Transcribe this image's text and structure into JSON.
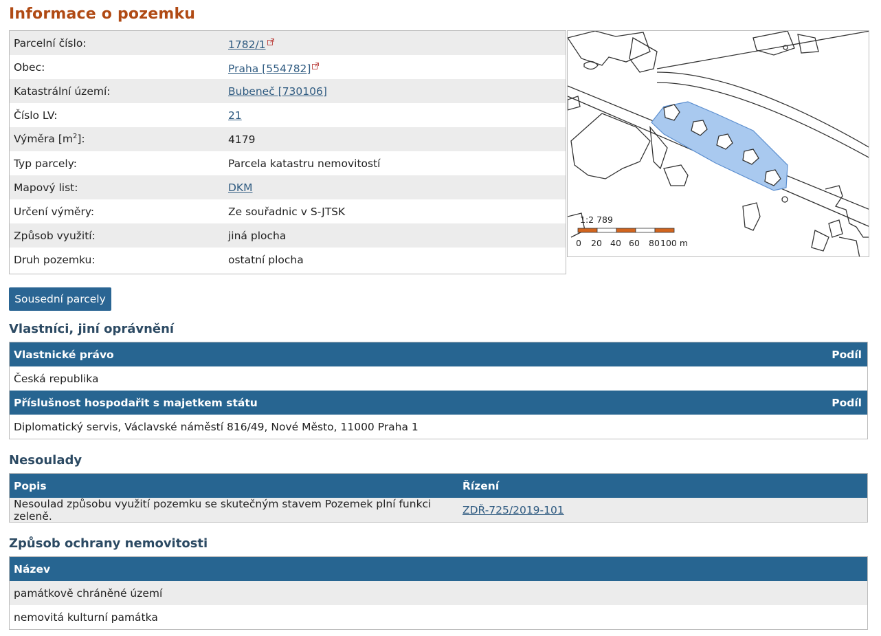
{
  "title": "Informace o pozemku",
  "parcel_info": [
    {
      "label": "Parcelní číslo:",
      "value": "1782/1",
      "link": true,
      "external": true
    },
    {
      "label": "Obec:",
      "value": "Praha [554782]",
      "link": true,
      "external": true
    },
    {
      "label": "Katastrální území:",
      "value": "Bubeneč [730106]",
      "link": true,
      "external": false
    },
    {
      "label": "Číslo LV:",
      "value": "21",
      "link": true,
      "external": false
    },
    {
      "label": "Výměra [m",
      "label_sup": "2",
      "label_suffix": "]:",
      "value": "4179",
      "link": false
    },
    {
      "label": "Typ parcely:",
      "value": "Parcela katastru nemovitostí",
      "link": false
    },
    {
      "label": "Mapový list:",
      "value": "DKM",
      "link": true,
      "external": false
    },
    {
      "label": "Určení výměry:",
      "value": "Ze souřadnic v S-JTSK",
      "link": false
    },
    {
      "label": "Způsob využití:",
      "value": "jiná plocha",
      "link": false
    },
    {
      "label": "Druh pozemku:",
      "value": "ostatní plocha",
      "link": false
    }
  ],
  "map": {
    "scale_ratio": "1:2 789",
    "scale_ticks": [
      "0",
      "20",
      "40",
      "60",
      "80",
      "100 m"
    ],
    "highlight_color": "#a9c9ef",
    "scale_bar_color": "#d2651e"
  },
  "neighbors_button": "Sousední parcely",
  "owners": {
    "heading": "Vlastníci, jiní oprávnění",
    "header1": {
      "name": "Vlastnické právo",
      "share": "Podíl"
    },
    "row1": "Česká republika",
    "header2": {
      "name": "Příslušnost hospodařit s majetkem státu",
      "share": "Podíl"
    },
    "row2": "Diplomatický servis, Václavské náměstí 816/49, Nové Město, 11000 Praha 1"
  },
  "discrepancies": {
    "heading": "Nesoulady",
    "col_desc": "Popis",
    "col_proc": "Řízení",
    "row_desc": "Nesoulad způsobu využití pozemku se skutečným stavem Pozemek plní funkci zeleně.",
    "row_proc": "ZDŘ-725/2019-101"
  },
  "protection": {
    "heading": "Způsob ochrany nemovitosti",
    "col_name": "Název",
    "rows": [
      "památkově chráněné území",
      "nemovitá kulturní památka"
    ]
  },
  "colors": {
    "title": "#b04a14",
    "header_bg": "#276591",
    "heading": "#2c4a63",
    "link": "#2e5a80"
  }
}
